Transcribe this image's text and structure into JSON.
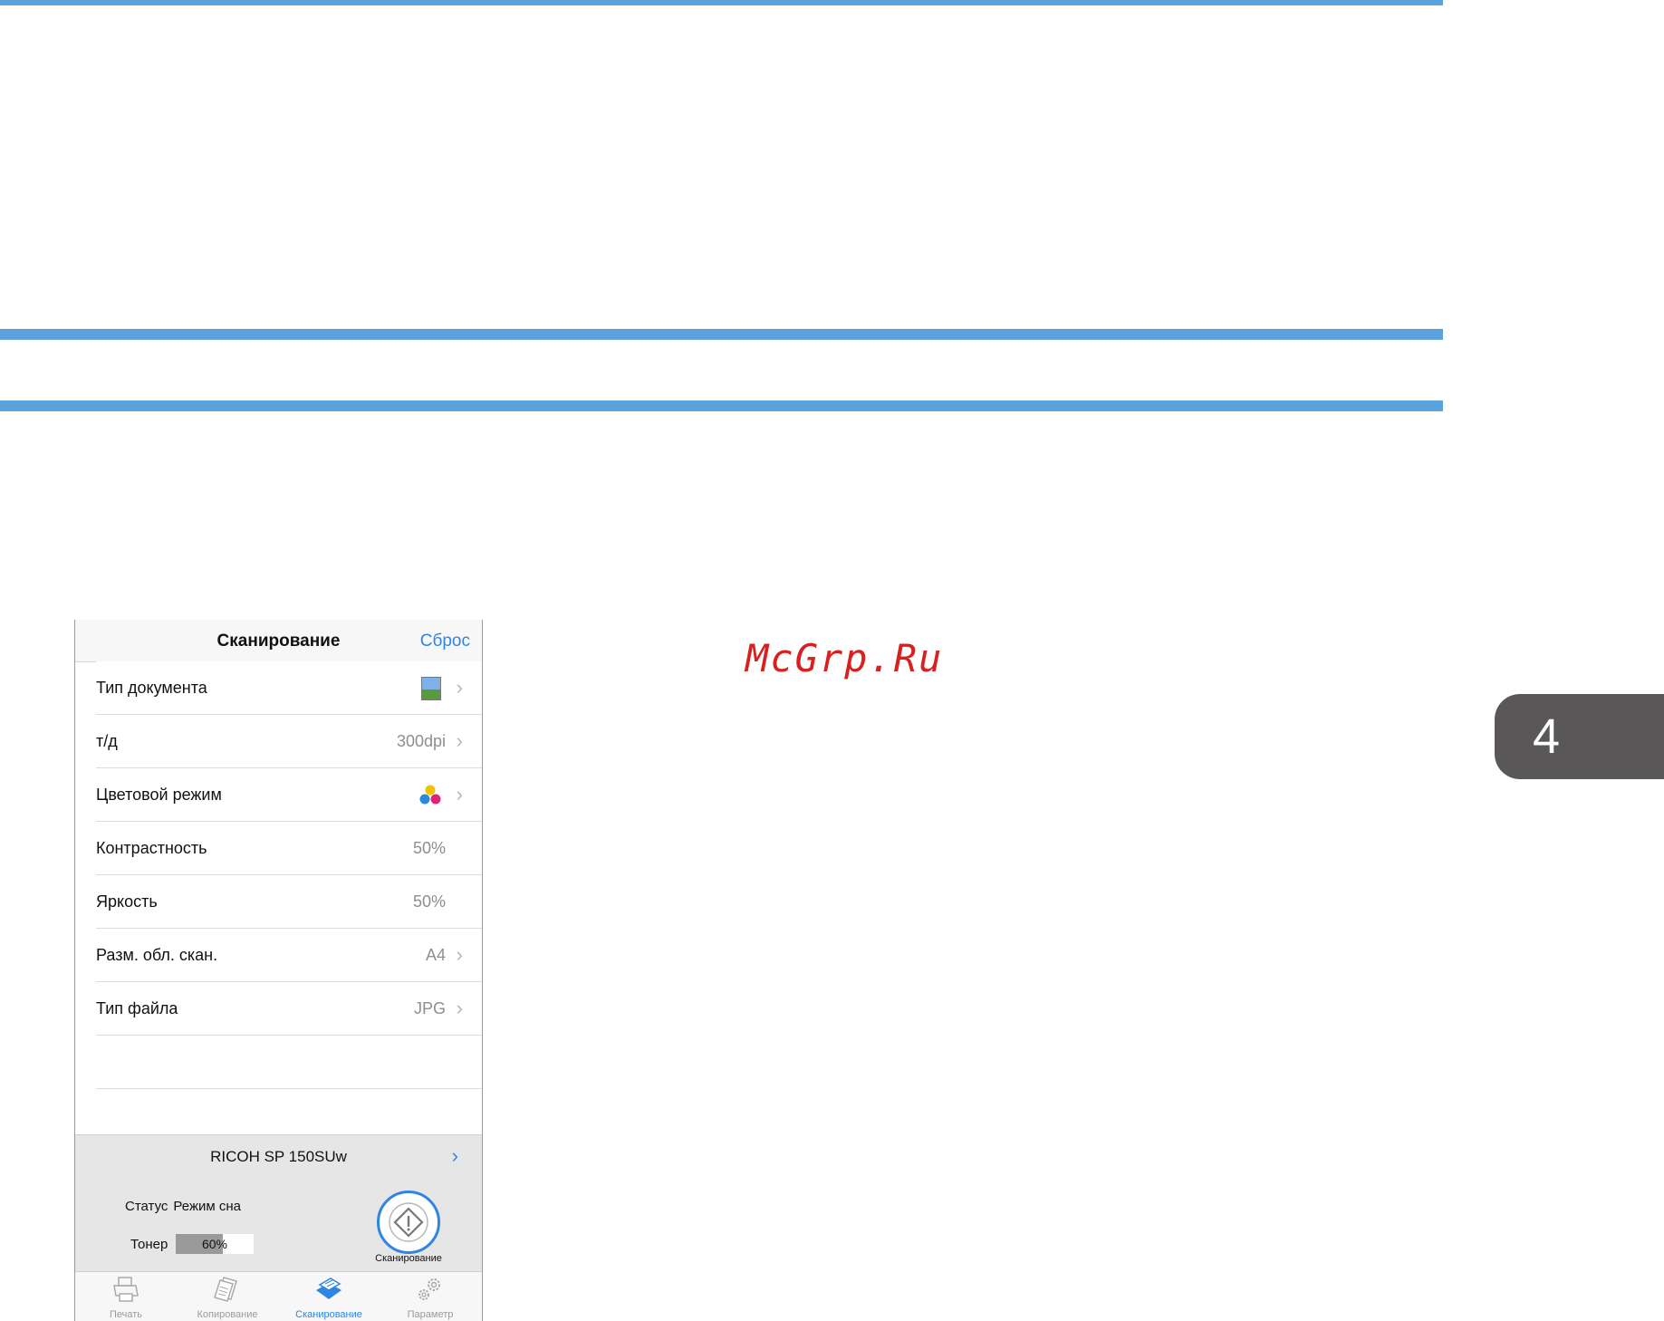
{
  "page": {
    "chapter_tab": "4",
    "watermark": "McGrp.Ru",
    "colors": {
      "accent_rule": "#5ba1dc",
      "tab": "#595757",
      "watermark": "#d9201f"
    }
  },
  "app": {
    "title": "Сканирование",
    "reset_label": "Сброс",
    "accent": "#2f86e2",
    "settings": [
      {
        "label": "Тип документа",
        "value": "",
        "icon": "document-photo-icon",
        "chevron": true
      },
      {
        "label": "т/д",
        "value": "300dpi",
        "chevron": true
      },
      {
        "label": "Цветовой режим",
        "value": "",
        "icon": "color-mode-icon",
        "chevron": true
      },
      {
        "label": "Контрастность",
        "value": "50%",
        "chevron": false
      },
      {
        "label": "Яркость",
        "value": "50%",
        "chevron": false
      },
      {
        "label": "Разм. обл. скан.",
        "value": "A4",
        "chevron": true
      },
      {
        "label": "Тип файла",
        "value": "JPG",
        "chevron": true
      }
    ],
    "printer": {
      "name": "RICOH SP 150SUw"
    },
    "status": {
      "label": "Статус",
      "value": "Режим сна"
    },
    "toner": {
      "label": "Тонер",
      "percent_text": "60%",
      "level": 0.6
    },
    "scan_button_label": "Сканирование",
    "tabs": [
      {
        "label": "Печать",
        "icon": "printer-icon",
        "active": false
      },
      {
        "label": "Копирование",
        "icon": "copy-icon",
        "active": false
      },
      {
        "label": "Сканирование",
        "icon": "scanner-icon",
        "active": true
      },
      {
        "label": "Параметр",
        "icon": "gear-icon",
        "active": false
      }
    ]
  }
}
